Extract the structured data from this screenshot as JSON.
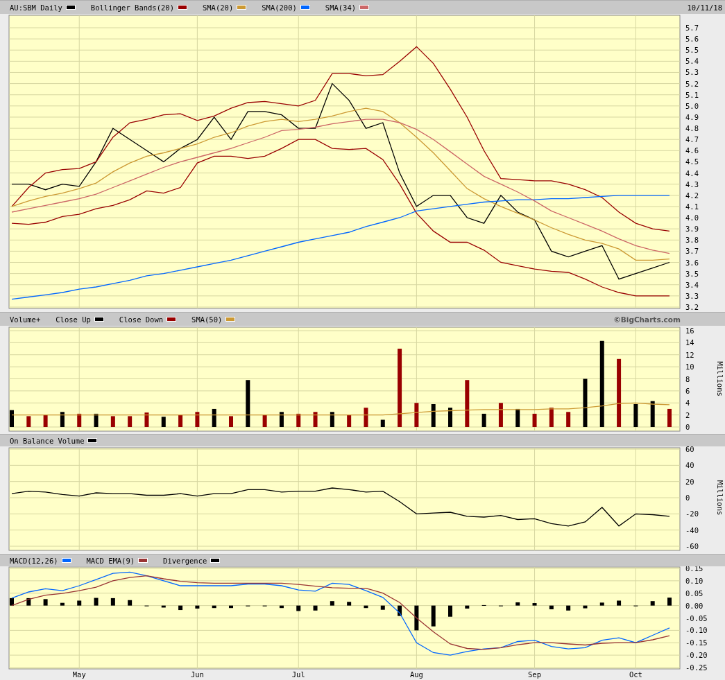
{
  "date": "10/11/18",
  "panels": [
    {
      "chart_data": {
        "type": "line",
        "grid": true,
        "categories": [
          null,
          null,
          null,
          null,
          null,
          null,
          null,
          null,
          null,
          null,
          null,
          null,
          null,
          null,
          null,
          null,
          null,
          null,
          null,
          null,
          null,
          null,
          null,
          null,
          null,
          null,
          null,
          null,
          null,
          null,
          null,
          null,
          null,
          null,
          null,
          null,
          null,
          null,
          null,
          null
        ],
        "ylim": [
          3.2,
          5.7
        ],
        "yticks": [
          3.2,
          3.3,
          3.4,
          3.5,
          3.6,
          3.7,
          3.8,
          3.9,
          {
            "value": 4,
            "label": "4.0"
          },
          4.1,
          4.2,
          4.3,
          4.4,
          4.5,
          4.6,
          4.7,
          4.8,
          4.9,
          {
            "value": 5,
            "label": "5.0"
          },
          5.1,
          5.2,
          5.3,
          5.4,
          5.5,
          5.6,
          5.7
        ],
        "series": [
          {
            "name": "AU:SBM Daily",
            "color": "#000000",
            "values": [
              4.3,
              4.3,
              4.25,
              4.3,
              4.28,
              4.5,
              4.8,
              4.7,
              4.6,
              4.5,
              4.62,
              4.7,
              4.9,
              4.7,
              4.95,
              4.95,
              4.92,
              4.8,
              4.8,
              5.2,
              5.05,
              4.8,
              4.85,
              4.4,
              4.1,
              4.2,
              4.2,
              4.0,
              3.95,
              4.2,
              4.05,
              3.98,
              3.7,
              3.65,
              3.7,
              3.75,
              3.45,
              3.5,
              3.55,
              3.6
            ]
          },
          {
            "name": "Bollinger Bands(20)",
            "color": "#990000",
            "values": [
              4.1,
              4.27,
              4.4,
              4.43,
              4.44,
              4.5,
              4.72,
              4.85,
              4.88,
              4.92,
              4.93,
              4.87,
              4.91,
              4.98,
              5.03,
              5.04,
              5.02,
              5.0,
              5.05,
              5.29,
              5.29,
              5.27,
              5.28,
              5.4,
              5.53,
              5.38,
              5.15,
              4.9,
              4.6,
              4.35,
              4.34,
              4.33,
              4.33,
              4.3,
              4.25,
              4.18,
              4.05,
              3.95,
              3.9,
              3.88
            ]
          },
          {
            "color": "#990000",
            "values": [
              3.95,
              3.94,
              3.96,
              4.01,
              4.03,
              4.08,
              4.11,
              4.16,
              4.24,
              4.22,
              4.27,
              4.49,
              4.55,
              4.55,
              4.53,
              4.55,
              4.62,
              4.7,
              4.7,
              4.62,
              4.61,
              4.62,
              4.52,
              4.3,
              4.04,
              3.88,
              3.78,
              3.78,
              3.71,
              3.6,
              3.57,
              3.54,
              3.52,
              3.51,
              3.45,
              3.38,
              3.33,
              3.3,
              3.3,
              3.3
            ]
          },
          {
            "name": "SMA(20)",
            "color": "#cc9933",
            "values": [
              4.1,
              4.15,
              4.19,
              4.22,
              4.26,
              4.31,
              4.41,
              4.49,
              4.55,
              4.58,
              4.62,
              4.66,
              4.72,
              4.76,
              4.82,
              4.86,
              4.88,
              4.86,
              4.88,
              4.91,
              4.95,
              4.98,
              4.95,
              4.85,
              4.72,
              4.58,
              4.42,
              4.26,
              4.17,
              4.1,
              4.04,
              3.98,
              3.91,
              3.85,
              3.8,
              3.77,
              3.72,
              3.62,
              3.62,
              3.63
            ]
          },
          {
            "name": "SMA(200)",
            "color": "#0066ff",
            "values": [
              3.27,
              3.29,
              3.31,
              3.33,
              3.36,
              3.38,
              3.41,
              3.44,
              3.48,
              3.5,
              3.53,
              3.56,
              3.59,
              3.62,
              3.66,
              3.7,
              3.74,
              3.78,
              3.81,
              3.84,
              3.87,
              3.92,
              3.96,
              4.0,
              4.06,
              4.08,
              4.1,
              4.12,
              4.14,
              4.15,
              4.16,
              4.16,
              4.17,
              4.17,
              4.18,
              4.19,
              4.2,
              4.2,
              4.2,
              4.2
            ]
          },
          {
            "name": "SMA(34)",
            "color": "#cc6666",
            "values": [
              4.05,
              4.08,
              4.11,
              4.14,
              4.17,
              4.21,
              4.27,
              4.33,
              4.39,
              4.45,
              4.5,
              4.54,
              4.58,
              4.62,
              4.67,
              4.72,
              4.78,
              4.79,
              4.81,
              4.84,
              4.86,
              4.88,
              4.88,
              4.85,
              4.79,
              4.7,
              4.59,
              4.48,
              4.37,
              4.3,
              4.23,
              4.15,
              4.06,
              4.0,
              3.94,
              3.88,
              3.81,
              3.75,
              3.71,
              3.68
            ]
          }
        ]
      }
    },
    {
      "credit": "©BigCharts.com",
      "chart_data": {
        "type": "bar",
        "grid": true,
        "title": "Volume+",
        "ylabel": "Millions",
        "categories": [
          null,
          null,
          null,
          null,
          null,
          null,
          null,
          null,
          null,
          null,
          null,
          null,
          null,
          null,
          null,
          null,
          null,
          null,
          null,
          null,
          null,
          null,
          null,
          null,
          null,
          null,
          null,
          null,
          null,
          null,
          null,
          null,
          null,
          null,
          null,
          null,
          null,
          null,
          null,
          null
        ],
        "ylim": [
          0,
          16
        ],
        "yticks": [
          0,
          2,
          4,
          6,
          8,
          10,
          12,
          14,
          16
        ],
        "series": [
          {
            "name": "Close Up",
            "color": "#000000",
            "values": [
              2.8,
              null,
              null,
              2.5,
              null,
              2.2,
              null,
              null,
              null,
              1.7,
              null,
              null,
              3.0,
              null,
              7.8,
              null,
              2.5,
              null,
              null,
              2.5,
              null,
              null,
              1.2,
              null,
              null,
              3.8,
              3.2,
              null,
              2.2,
              null,
              3.0,
              null,
              null,
              null,
              8.0,
              14.3,
              null,
              3.8,
              4.3,
              null
            ]
          },
          {
            "name": "Close Down",
            "color": "#990000",
            "values": [
              null,
              1.8,
              2.0,
              null,
              2.2,
              null,
              1.8,
              1.8,
              2.4,
              null,
              2.0,
              2.5,
              null,
              1.8,
              null,
              2.0,
              null,
              2.2,
              2.5,
              null,
              2.0,
              3.2,
              null,
              13.0,
              4.0,
              null,
              null,
              7.8,
              null,
              4.0,
              null,
              2.2,
              3.2,
              2.5,
              null,
              null,
              11.3,
              null,
              null,
              3.0
            ]
          },
          {
            "name": "SMA(50)",
            "color": "#cc9933",
            "type": "line",
            "values": [
              2.0,
              2.0,
              2.0,
              2.0,
              2.0,
              2.0,
              2.0,
              2.0,
              2.0,
              2.0,
              2.0,
              2.0,
              2.0,
              2.0,
              2.0,
              2.0,
              2.0,
              2.0,
              2.0,
              2.0,
              2.0,
              2.0,
              2.0,
              2.2,
              2.4,
              2.6,
              2.7,
              2.8,
              2.9,
              2.9,
              2.9,
              2.9,
              3.0,
              3.0,
              3.2,
              3.5,
              3.9,
              4.0,
              3.8,
              3.7
            ]
          }
        ]
      }
    },
    {
      "chart_data": {
        "type": "line",
        "grid": true,
        "ylabel": "Millions",
        "categories": [
          null,
          null,
          null,
          null,
          null,
          null,
          null,
          null,
          null,
          null,
          null,
          null,
          null,
          null,
          null,
          null,
          null,
          null,
          null,
          null,
          null,
          null,
          null,
          null,
          null,
          null,
          null,
          null,
          null,
          null,
          null,
          null,
          null,
          null,
          null,
          null,
          null,
          null,
          null,
          null
        ],
        "ylim": [
          -60,
          60
        ],
        "yticks": [
          -60,
          -40,
          -20,
          0,
          20,
          40,
          60
        ],
        "series": [
          {
            "name": "On Balance Volume",
            "color": "#000000",
            "values": [
              5,
              8,
              7,
              4,
              2,
              6,
              5,
              5,
              3,
              3,
              5,
              2,
              5,
              5,
              10,
              10,
              7,
              8,
              8,
              12,
              10,
              7,
              8,
              -5,
              -20,
              -19,
              -18,
              -23,
              -24,
              -22,
              -27,
              -26,
              -32,
              -35,
              -30,
              -12,
              -35,
              -20,
              -21,
              -23
            ]
          }
        ]
      }
    },
    {
      "chart_data": {
        "type": "line",
        "grid": true,
        "categories": [
          null,
          null,
          null,
          null,
          "May",
          null,
          null,
          null,
          null,
          null,
          null,
          "Jun",
          null,
          null,
          null,
          null,
          null,
          "Jul",
          null,
          null,
          null,
          null,
          null,
          null,
          "Aug",
          null,
          null,
          null,
          null,
          null,
          null,
          "Sep",
          null,
          null,
          null,
          null,
          null,
          "Oct",
          null,
          null
        ],
        "ylim": [
          -0.25,
          0.15
        ],
        "yticks": [
          -0.25,
          {
            "value": -0.2,
            "label": "-0.20"
          },
          -0.15,
          {
            "value": -0.1,
            "label": "-0.10"
          },
          -0.05,
          {
            "value": 0,
            "label": "0.00"
          },
          0.05,
          {
            "value": 0.1,
            "label": "0.10"
          },
          0.15
        ],
        "series": [
          {
            "name": "MACD(12,26)",
            "color": "#0066ff",
            "values": [
              0.03,
              0.055,
              0.068,
              0.06,
              0.08,
              0.105,
              0.13,
              0.135,
              0.12,
              0.1,
              0.08,
              0.08,
              0.08,
              0.08,
              0.087,
              0.087,
              0.08,
              0.063,
              0.058,
              0.09,
              0.085,
              0.06,
              0.033,
              -0.03,
              -0.15,
              -0.19,
              -0.2,
              -0.185,
              -0.175,
              -0.17,
              -0.145,
              -0.14,
              -0.165,
              -0.175,
              -0.17,
              -0.14,
              -0.13,
              -0.15,
              -0.12,
              -0.09
            ]
          },
          {
            "name": "MACD EMA(9)",
            "color": "#993333",
            "values": [
              0,
              0.025,
              0.042,
              0.049,
              0.06,
              0.074,
              0.1,
              0.113,
              0.12,
              0.108,
              0.098,
              0.092,
              0.09,
              0.09,
              0.09,
              0.09,
              0.09,
              0.085,
              0.078,
              0.072,
              0.07,
              0.07,
              0.05,
              0.012,
              -0.05,
              -0.106,
              -0.155,
              -0.173,
              -0.177,
              -0.17,
              -0.158,
              -0.15,
              -0.15,
              -0.155,
              -0.159,
              -0.152,
              -0.15,
              -0.15,
              -0.138,
              -0.122
            ]
          },
          {
            "name": "Divergence",
            "color": "#000000",
            "type": "bar",
            "values": [
              0.03,
              0.03,
              0.026,
              0.011,
              0.02,
              0.031,
              0.03,
              0.022,
              0,
              -0.008,
              -0.018,
              -0.012,
              -0.01,
              -0.01,
              -0.003,
              -0.003,
              -0.01,
              -0.022,
              -0.02,
              0.018,
              0.015,
              -0.01,
              -0.017,
              -0.042,
              -0.1,
              -0.084,
              -0.045,
              -0.012,
              0.002,
              0,
              0.013,
              0.01,
              -0.015,
              -0.02,
              -0.011,
              0.012,
              0.02,
              0,
              0.018,
              0.032
            ]
          }
        ]
      }
    }
  ]
}
